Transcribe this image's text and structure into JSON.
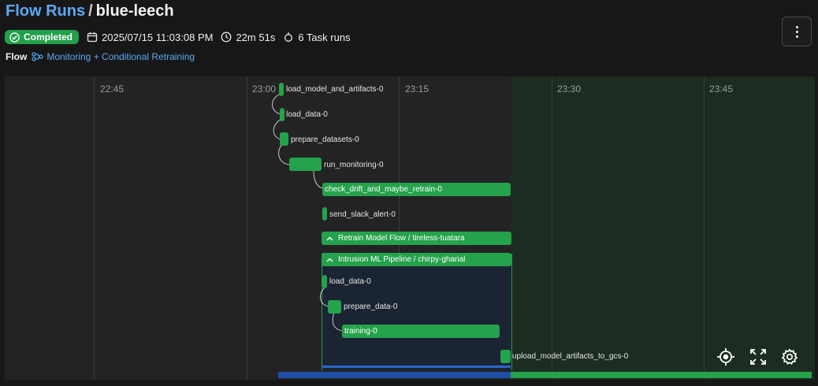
{
  "header": {
    "breadcrumb_root": "Flow Runs",
    "separator": "/",
    "run_name": "blue-leech"
  },
  "meta": {
    "status": "Completed",
    "start_time": "2025/07/15 11:03:08 PM",
    "duration": "22m 51s",
    "task_runs": "6 Task runs"
  },
  "flow": {
    "label": "Flow",
    "name": "Monitoring + Conditional Retraining"
  },
  "timeline": {
    "ticks": [
      "22:45",
      "23:00",
      "23:15",
      "23:30",
      "23:45"
    ],
    "tasks": [
      "load_model_and_artifacts-0",
      "load_data-0",
      "prepare_datasets-0",
      "run_monitoring-0",
      "check_drift_and_maybe_retrain-0",
      "send_slack_alert-0"
    ],
    "subflows": [
      "Retrain Model Flow / tireless-tuatara",
      "Intrusion ML Pipeline / chirpy-gharial"
    ],
    "subflow_tasks": [
      "load_data-0",
      "prepare_data-0",
      "training-0",
      "upload_model_artifacts_to_gcs-0"
    ]
  },
  "colors": {
    "accent": "#5aa9f5",
    "success": "#24a24c",
    "subflow_bg": "#1b2433",
    "future_bg": "#1c2c20"
  },
  "icons": [
    "calendar-icon",
    "clock-icon",
    "task-run-icon",
    "flow-icon",
    "kebab-menu-icon",
    "crosshair-icon",
    "fullscreen-icon",
    "settings-icon",
    "chevron-up-icon"
  ]
}
